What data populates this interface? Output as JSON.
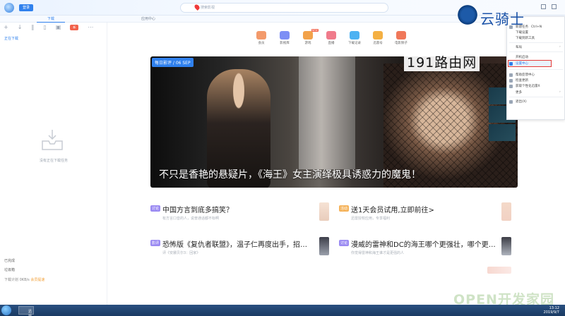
{
  "app": {
    "login_label": "登录",
    "search_placeholder": "搜索影视"
  },
  "tabs": [
    {
      "label": "下载"
    },
    {
      "label": "应用中心"
    }
  ],
  "left": {
    "toolbar_badge": "新",
    "downloading_label": "正在下载",
    "empty_text": "没有正在下载任务",
    "completed_label": "已完成",
    "trash_label": "垃圾箱",
    "speed_prefix": "下载计划",
    "speed_value": "0KB/s",
    "speed_suffix": "会员提速"
  },
  "nav": [
    {
      "label": "会员",
      "color": "#f39a6b"
    },
    {
      "label": "影视库",
      "color": "#7d8ff5"
    },
    {
      "label": "游戏",
      "color": "#f2a24a",
      "badge": "NEW"
    },
    {
      "label": "直播",
      "color": "#f07b8b"
    },
    {
      "label": "下载记录",
      "color": "#4db2f2"
    },
    {
      "label": "迅雷号",
      "color": "#f4b043"
    },
    {
      "label": "电影频子",
      "color": "#f0785a"
    }
  ],
  "hero": {
    "tag": "每日影评 / 06 SEP",
    "caption": "不只是香艳的悬疑片，《海王》女主演绎极具诱惑力的魔鬼！"
  },
  "news": [
    {
      "tag": "讨论",
      "tag_color": "#9b8bf2",
      "title": "中国方言到底多搞笑？",
      "sub": "有方言口音的人，说普通话都不标啊"
    },
    {
      "tag": "活动",
      "tag_color": "#f5b35b",
      "title": "送1天会员试用,立即前往>",
      "sub": "迅雷授权应用，专享福利"
    },
    {
      "tag": "影评",
      "tag_color": "#9b8bf2",
      "title": "恐怖版《复仇者联盟》，温子仁再度出手，招…",
      "sub": "评《安娜贝尔3：回家》"
    },
    {
      "tag": "讨论",
      "tag_color": "#9b8bf2",
      "title": "漫威的雷神和DC的海王哪个更强壮，哪个更…",
      "sub": "你觉得雷神和海王谁才是更强的人"
    }
  ],
  "menu": {
    "items": [
      {
        "label": "新建任务",
        "shortcut": "Ctrl+N"
      },
      {
        "label": "下载设置"
      },
      {
        "label": "下载到新工具"
      },
      {
        "label": "布局",
        "arrow": "›"
      },
      {
        "label": "开机启动"
      },
      {
        "label": "设置中心"
      },
      {
        "label": "帮助反馈中心"
      },
      {
        "label": "检查更新"
      },
      {
        "label": "获取个性化迅雷X"
      },
      {
        "label": "更多",
        "arrow": "›"
      },
      {
        "label": "退出(X)"
      }
    ]
  },
  "watermarks": {
    "top_right": "云骑士",
    "mid_right": "191路由网",
    "bottom_right": "OPEN开发家园"
  },
  "taskbar": {
    "item_label": "迅雷",
    "time": "13:12",
    "date": "2019/9/7"
  }
}
